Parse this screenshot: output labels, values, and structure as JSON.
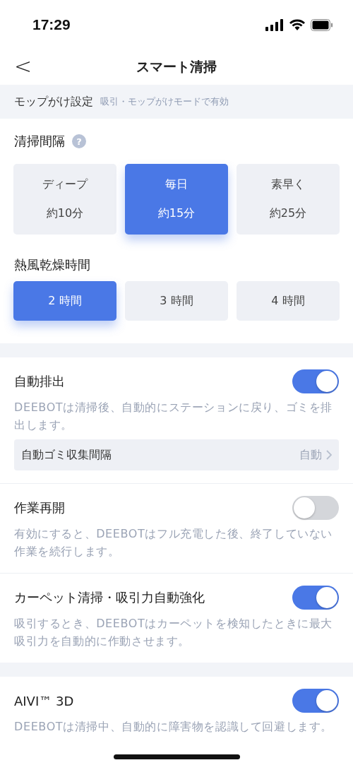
{
  "status_bar": {
    "time": "17:29"
  },
  "nav": {
    "back": "<",
    "title": "スマート清掃"
  },
  "mop_header": {
    "title": "モップがけ設定",
    "note": "吸引・モップがけモードで有効"
  },
  "interval": {
    "label": "清掃間隔",
    "help": "?",
    "options": [
      {
        "name": "ディープ",
        "time": "約10分",
        "selected": false
      },
      {
        "name": "毎日",
        "time": "約15分",
        "selected": true
      },
      {
        "name": "素早く",
        "time": "約25分",
        "selected": false
      }
    ]
  },
  "drying": {
    "label": "熱風乾燥時間",
    "options": [
      {
        "label": "2 時間",
        "selected": true
      },
      {
        "label": "3 時間",
        "selected": false
      },
      {
        "label": "4 時間",
        "selected": false
      }
    ]
  },
  "settings": [
    {
      "title": "自動排出",
      "on": true,
      "description": "DEEBOTは清掃後、自動的にステーションに戻り、ゴミを排出します。",
      "sub_row": {
        "label": "自動ゴミ収集間隔",
        "value": "自動"
      }
    },
    {
      "title": "作業再開",
      "on": false,
      "description": "有効にすると、DEEBOTはフル充電した後、終了していない作業を続行します。"
    },
    {
      "title": "カーペット清掃・吸引力自動強化",
      "on": true,
      "description": "吸引するとき、DEEBOTはカーペットを検知したときに最大吸引力を自動的に作動させます。"
    },
    {
      "title": "AIVI™ 3D",
      "on": true,
      "description": "DEEBOTは清掃中、自動的に障害物を認識して回避します。",
      "group_start": true
    }
  ]
}
